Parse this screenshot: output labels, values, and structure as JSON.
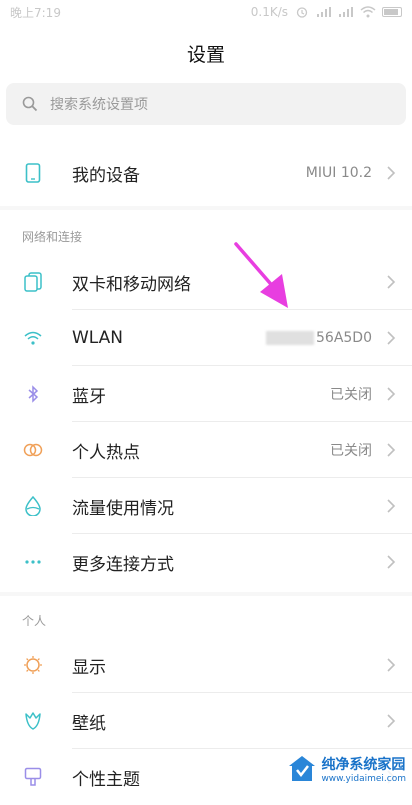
{
  "status_bar": {
    "time": "晚上7:19",
    "speed": "0.1K/s"
  },
  "header": {
    "title": "设置"
  },
  "search": {
    "placeholder": "搜索系统设置项"
  },
  "device_row": {
    "label": "我的设备",
    "value": "MIUI 10.2",
    "icon": "phone-icon"
  },
  "section_network": {
    "label": "网络和连接",
    "items": [
      {
        "label": "双卡和移动网络",
        "value": "",
        "icon": "sim-card-icon"
      },
      {
        "label": "WLAN",
        "value": "56A5D0",
        "icon": "wifi-icon"
      },
      {
        "label": "蓝牙",
        "value": "已关闭",
        "icon": "bluetooth-icon"
      },
      {
        "label": "个人热点",
        "value": "已关闭",
        "icon": "hotspot-icon"
      },
      {
        "label": "流量使用情况",
        "value": "",
        "icon": "data-usage-icon"
      },
      {
        "label": "更多连接方式",
        "value": "",
        "icon": "more-dots-icon"
      }
    ]
  },
  "section_personal": {
    "label": "个人",
    "items": [
      {
        "label": "显示",
        "value": "",
        "icon": "display-icon"
      },
      {
        "label": "壁纸",
        "value": "",
        "icon": "wallpaper-icon"
      },
      {
        "label": "个性主题",
        "value": "",
        "icon": "theme-icon"
      }
    ]
  },
  "watermark": {
    "name": "纯净系统家园",
    "url": "www.yidaimei.com"
  },
  "colors": {
    "arrow": "#e83ee0",
    "accent": "#3cc0c8"
  }
}
